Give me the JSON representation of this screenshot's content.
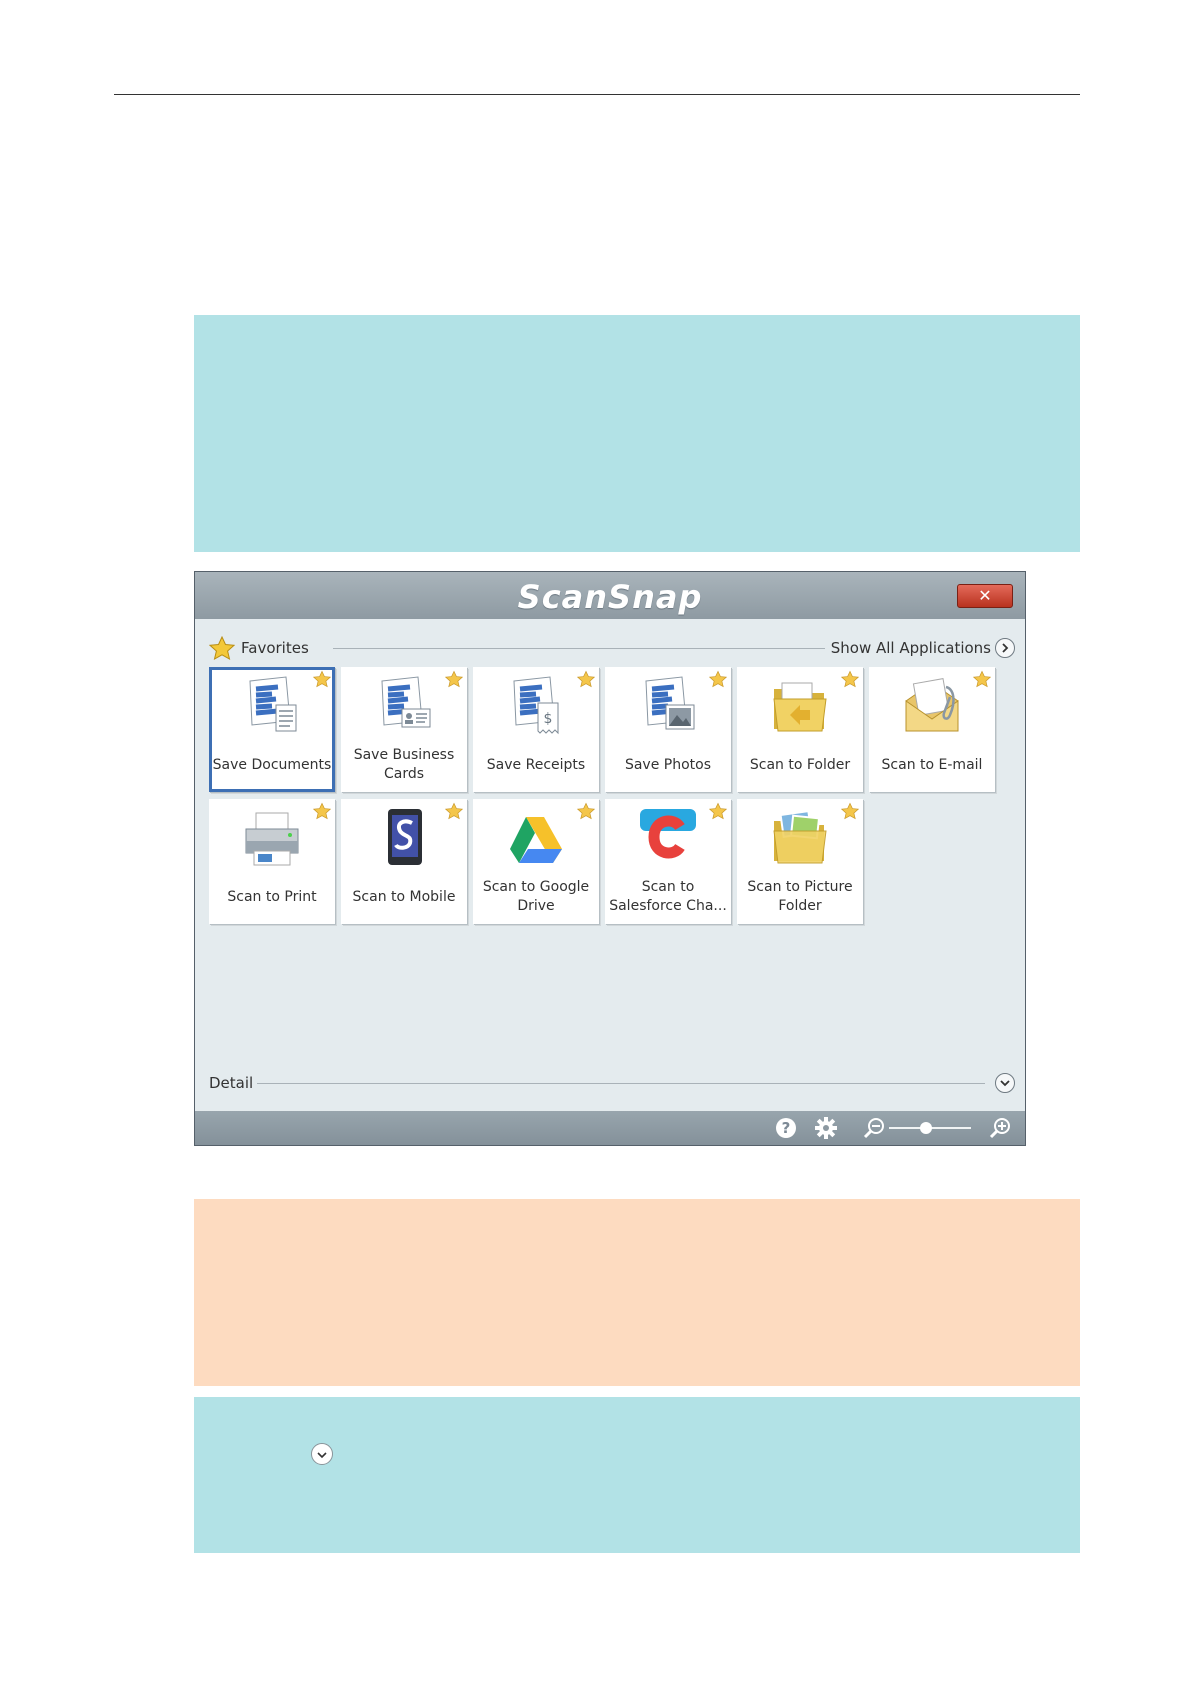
{
  "window": {
    "title": "ScanSnap",
    "close_label": "✕"
  },
  "favorites": {
    "label": "Favorites",
    "show_all_label": "Show All Applications"
  },
  "tiles": [
    {
      "label": "Save Documents",
      "icon": "save-documents-icon",
      "selected": true
    },
    {
      "label": "Save Business Cards",
      "icon": "save-business-cards-icon"
    },
    {
      "label": "Save Receipts",
      "icon": "save-receipts-icon"
    },
    {
      "label": "Save Photos",
      "icon": "save-photos-icon"
    },
    {
      "label": "Scan to Folder",
      "icon": "folder-icon"
    },
    {
      "label": "Scan to E-mail",
      "icon": "email-icon"
    },
    {
      "label": "Scan to Print",
      "icon": "printer-icon"
    },
    {
      "label": "Scan to Mobile",
      "icon": "mobile-icon"
    },
    {
      "label": "Scan to Google Drive",
      "icon": "google-drive-icon"
    },
    {
      "label": "Scan to Salesforce Cha...",
      "icon": "salesforce-chatter-icon"
    },
    {
      "label": "Scan to Picture Folder",
      "icon": "picture-folder-icon"
    }
  ],
  "detail": {
    "label": "Detail"
  },
  "toolbar": {
    "help_icon": "help-icon",
    "settings_icon": "gear-icon",
    "zoom_out_icon": "zoom-out-icon",
    "zoom_in_icon": "zoom-in-icon"
  },
  "colors": {
    "hint_background": "#b2e2e6",
    "note_background": "#fddbc0",
    "selection": "#3d6fb4"
  }
}
